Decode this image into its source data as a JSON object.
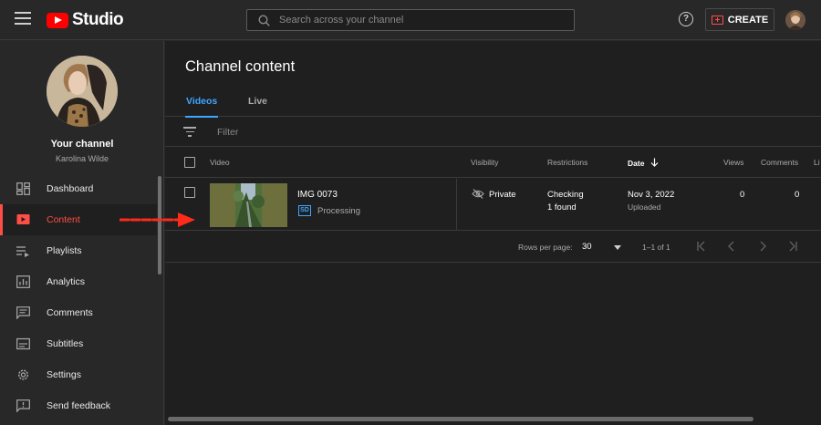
{
  "header": {
    "logo_text": "Studio",
    "search_placeholder": "Search across your channel",
    "create_label": "CREATE"
  },
  "sidebar": {
    "your_channel": "Your channel",
    "channel_name": "Karolina Wilde",
    "items": [
      {
        "label": "Dashboard",
        "icon": "dashboard-icon",
        "active": false
      },
      {
        "label": "Content",
        "icon": "content-icon",
        "active": true
      },
      {
        "label": "Playlists",
        "icon": "playlists-icon",
        "active": false
      },
      {
        "label": "Analytics",
        "icon": "analytics-icon",
        "active": false
      },
      {
        "label": "Comments",
        "icon": "comments-icon",
        "active": false
      },
      {
        "label": "Subtitles",
        "icon": "subtitles-icon",
        "active": false
      },
      {
        "label": "Settings",
        "icon": "gear-icon",
        "active": false
      },
      {
        "label": "Send feedback",
        "icon": "feedback-icon",
        "active": false
      }
    ]
  },
  "main": {
    "title": "Channel content",
    "tabs": [
      {
        "label": "Videos",
        "active": true
      },
      {
        "label": "Live",
        "active": false
      }
    ],
    "filter_placeholder": "Filter",
    "columns": {
      "video": "Video",
      "visibility": "Visibility",
      "restrictions": "Restrictions",
      "date": "Date",
      "views": "Views",
      "comments": "Comments",
      "likes": "Li"
    },
    "rows": [
      {
        "title": "IMG 0073",
        "quality_badge": "SD",
        "status": "Processing",
        "visibility": "Private",
        "restrictions_line1": "Checking",
        "restrictions_line2": "1 found",
        "date": "Nov 3, 2022",
        "date_status": "Uploaded",
        "views": "0",
        "comments": "0"
      }
    ],
    "pagination": {
      "rows_per_page_label": "Rows per page:",
      "rows_per_page": "30",
      "range": "1–1 of 1"
    }
  },
  "colors": {
    "accent_red": "#ff4e45",
    "accent_blue": "#3ea6ff",
    "background": "#282828",
    "content_background": "#1f1f1f"
  }
}
